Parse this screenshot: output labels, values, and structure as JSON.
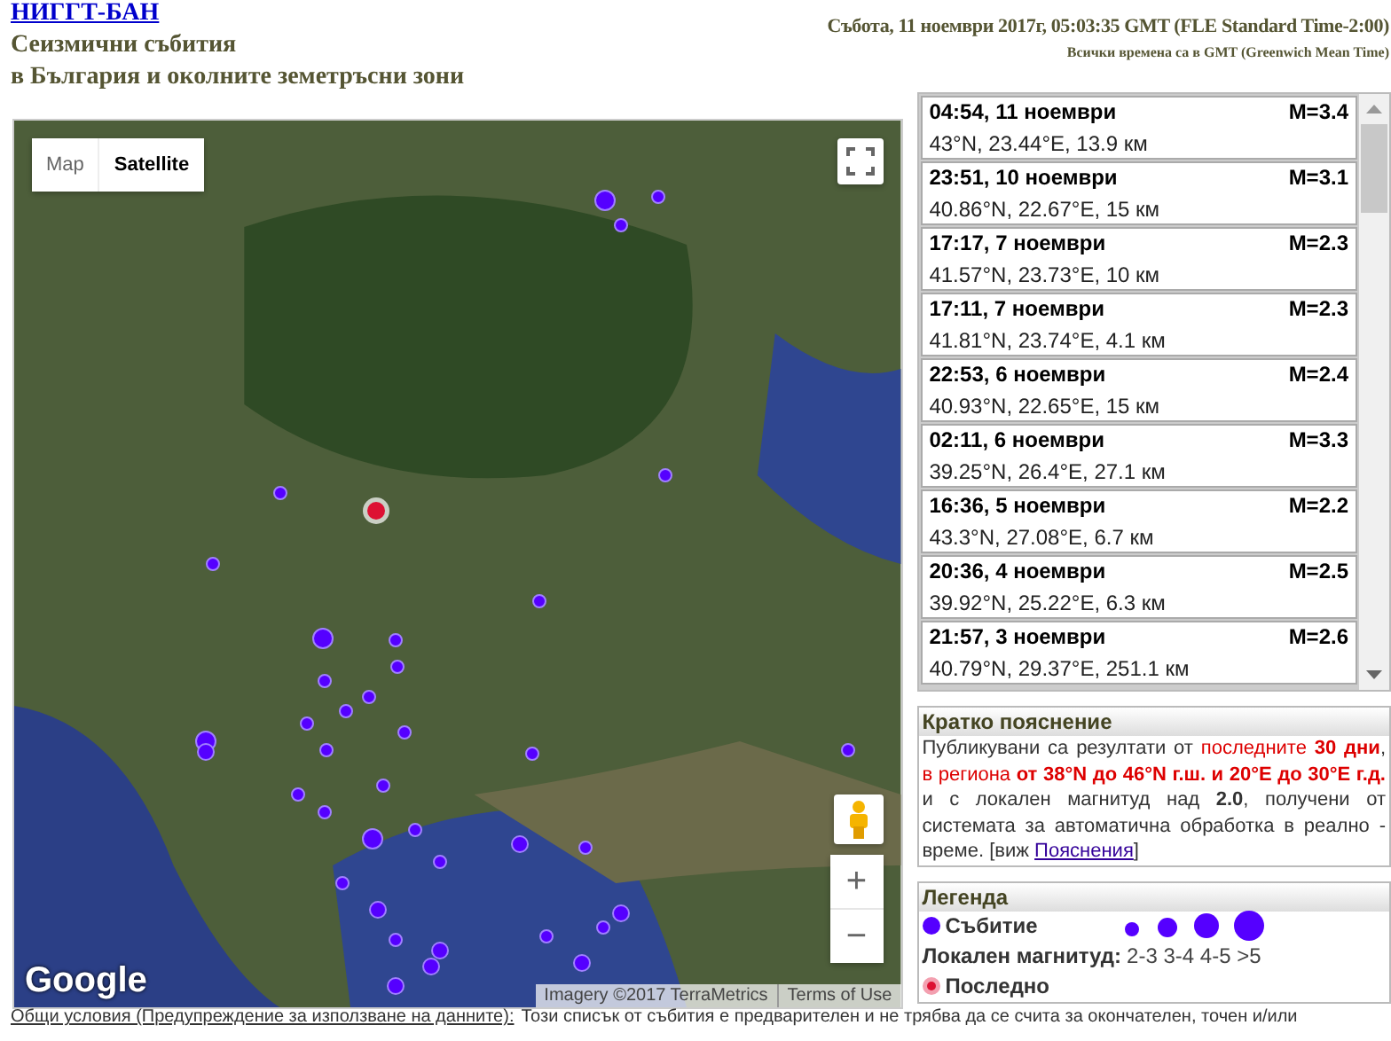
{
  "header": {
    "site_link": "НИГГТ-БАН",
    "title_line_1": "Сеизмични събития",
    "title_line_2": "в България и околните земетръсни зони",
    "date": "Събота, 11 ноември 2017г, 05:03:35 GMT (FLE Standard Time-2:00)",
    "time_note": "Всички времена са в  GMT (Greenwich Mean Time)"
  },
  "map": {
    "type_buttons": [
      {
        "label": "Map",
        "selected": false
      },
      {
        "label": "Satellite",
        "selected": true
      }
    ],
    "zoom_in": "+",
    "zoom_out": "−",
    "logo": "Google",
    "imagery": "Imagery ©2017 TerraMetrics",
    "terms": "Terms of Use"
  },
  "events": [
    {
      "time": "04:54, 11 ноември",
      "magnitude": "M=3.4",
      "location": "43°N, 23.44°E, 13.9 км"
    },
    {
      "time": "23:51, 10 ноември",
      "magnitude": "M=3.1",
      "location": "40.86°N, 22.67°E, 15 км"
    },
    {
      "time": "17:17, 7 ноември",
      "magnitude": "M=2.3",
      "location": "41.57°N, 23.73°E, 10 км"
    },
    {
      "time": "17:11, 7 ноември",
      "magnitude": "M=2.3",
      "location": "41.81°N, 23.74°E, 4.1 км"
    },
    {
      "time": "22:53, 6 ноември",
      "magnitude": "M=2.4",
      "location": "40.93°N, 22.65°E, 15 км"
    },
    {
      "time": "02:11, 6 ноември",
      "magnitude": "M=3.3",
      "location": "39.25°N, 26.4°E, 27.1 км"
    },
    {
      "time": "16:36, 5 ноември",
      "magnitude": "M=2.2",
      "location": "43.3°N, 27.08°E, 6.7 км"
    },
    {
      "time": "20:36, 4 ноември",
      "magnitude": "M=2.5",
      "location": "39.92°N, 25.22°E, 6.3 км"
    },
    {
      "time": "21:57, 3 ноември",
      "magnitude": "M=2.6",
      "location": "40.79°N, 29.37°E, 251.1 км"
    }
  ],
  "explanation": {
    "title": "Кратко пояснение",
    "segments": [
      {
        "kind": "plain",
        "text": "Публикувани са резултати от "
      },
      {
        "kind": "red",
        "text": "последните "
      },
      {
        "kind": "red-bold",
        "text": "30 дни"
      },
      {
        "kind": "plain",
        "text": ", "
      },
      {
        "kind": "red",
        "text": "в региона "
      },
      {
        "kind": "red-bold",
        "text": "от 38°N до 46°N г.ш. и 20°E до 30°E г.д."
      },
      {
        "kind": "plain",
        "text": " и с локален магнитуд над "
      },
      {
        "kind": "bold",
        "text": "2.0"
      },
      {
        "kind": "plain",
        "text": ", получени от системата за автоматична обработка в реално - време. [виж "
      },
      {
        "kind": "link",
        "text": "Пояснения"
      },
      {
        "kind": "plain",
        "text": "]"
      }
    ]
  },
  "legend": {
    "title": "Легенда",
    "event_label": "Събитие",
    "magnitude_label": "Локален магнитуд:",
    "ranges": "2-3 3-4 4-5 >5",
    "latest_label": "Последно"
  },
  "footer": {
    "terms_link": "Общи условия (Предупреждение за използване на данните):",
    "text": "Този списък от събития е предварителен и не трябва да се счита за окончателен, точен и/или"
  }
}
